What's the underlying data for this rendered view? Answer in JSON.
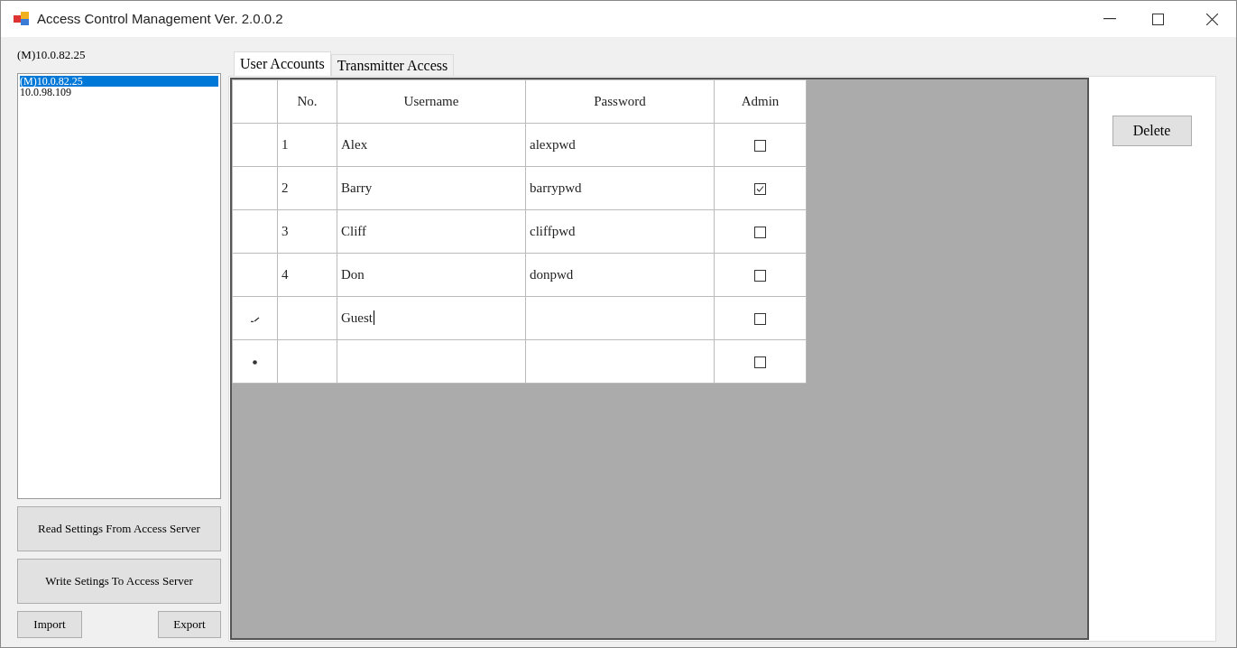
{
  "window": {
    "title": "Access Control Management Ver. 2.0.0.2"
  },
  "server_label": "(M)10.0.82.25",
  "servers": [
    {
      "label": "(M)10.0.82.25",
      "selected": true
    },
    {
      "label": "10.0.98.109",
      "selected": false
    }
  ],
  "side_buttons": [
    "Read Settings From Access Server",
    "Write Setings To Access Server"
  ],
  "import_button": "Import",
  "export_button": "Export",
  "tabs": [
    {
      "label": "User Accounts",
      "selected": true
    },
    {
      "label": "Transmitter Access",
      "selected": false
    }
  ],
  "table": {
    "columns": [
      "No.",
      "Username",
      "Password",
      "Admin"
    ],
    "rows": [
      {
        "kind": "saved",
        "no": "1",
        "username": "Alex",
        "password": "alexpwd",
        "admin": false
      },
      {
        "kind": "saved",
        "no": "2",
        "username": "Barry",
        "password": "barrypwd",
        "admin": true
      },
      {
        "kind": "saved",
        "no": "3",
        "username": "Cliff",
        "password": "cliffpwd",
        "admin": false
      },
      {
        "kind": "saved",
        "no": "4",
        "username": "Don",
        "password": "donpwd",
        "admin": false
      },
      {
        "kind": "editing",
        "no": "",
        "username": "Guest",
        "password": "",
        "admin": false
      },
      {
        "kind": "new",
        "no": "",
        "username": "",
        "password": "",
        "admin": false
      }
    ]
  },
  "delete_button": "Delete"
}
